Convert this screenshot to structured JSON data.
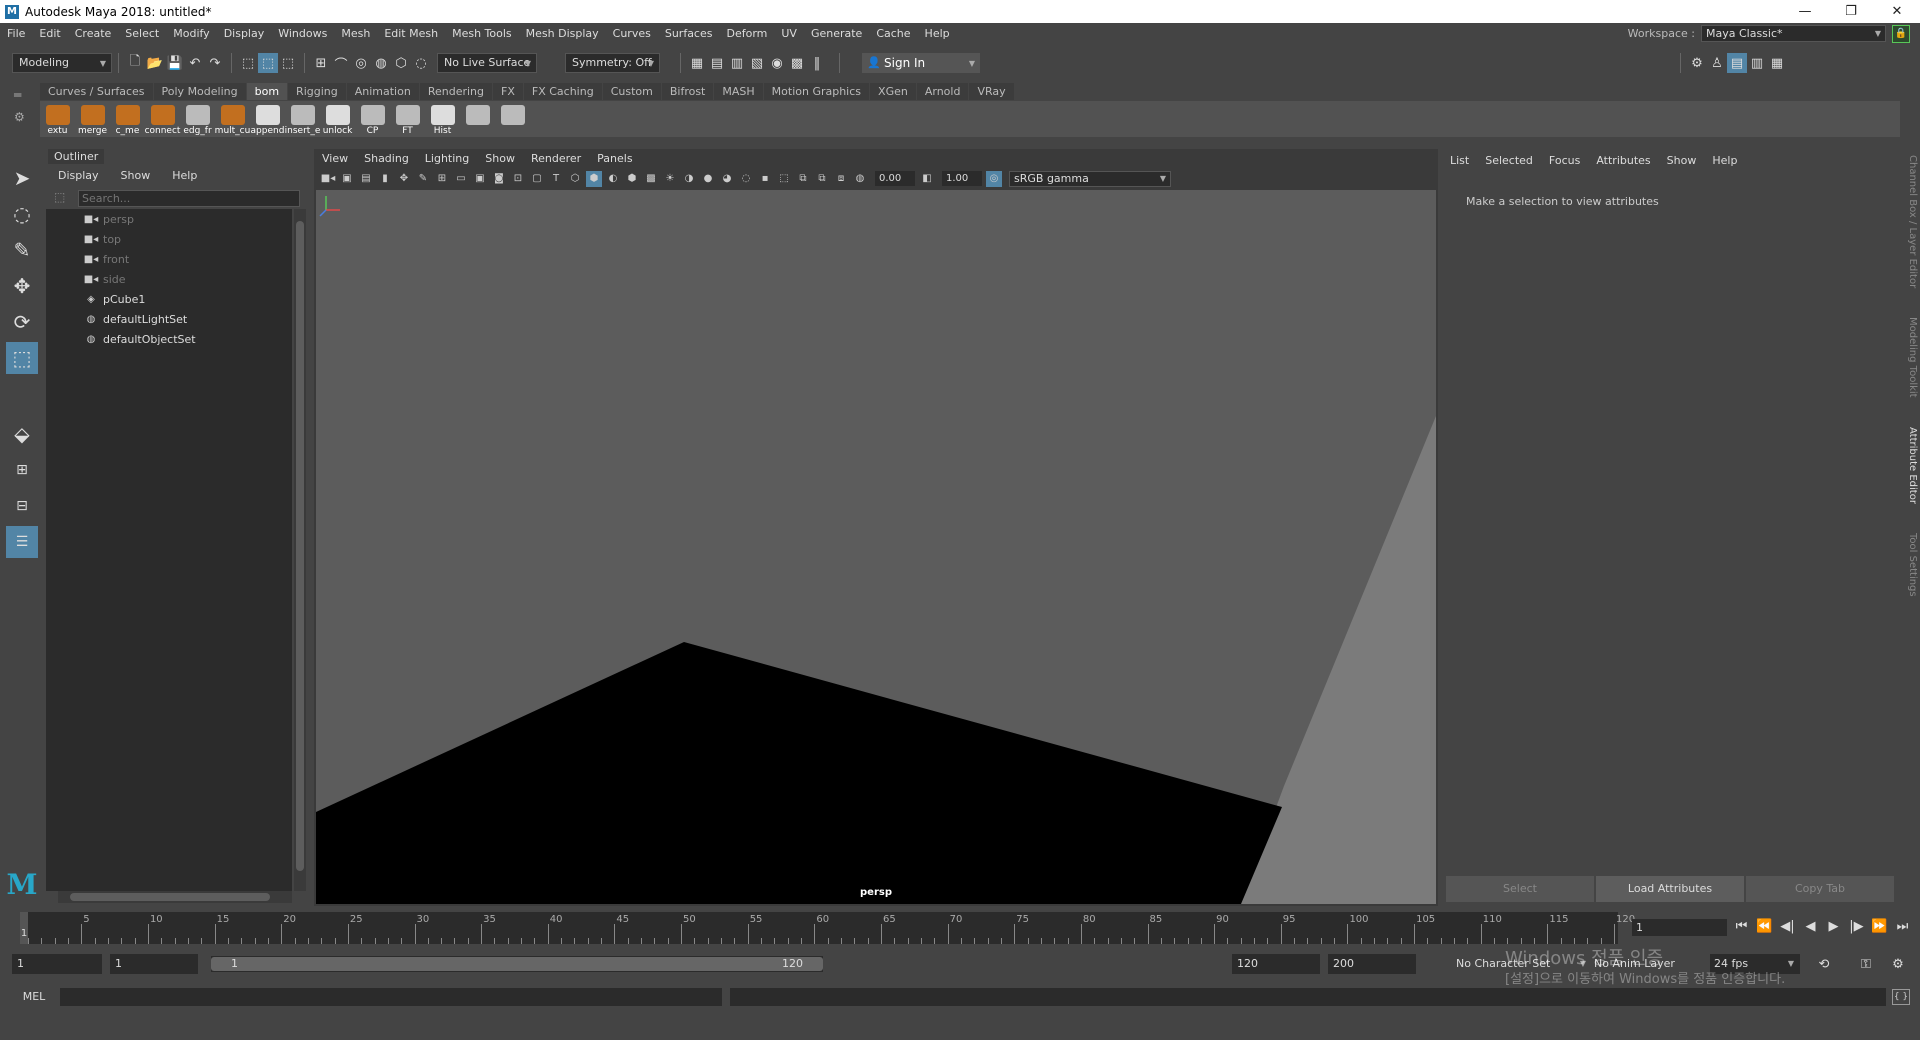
{
  "window": {
    "title": "Autodesk Maya 2018: untitled*",
    "app_icon": "M",
    "controls": [
      "—",
      "❐",
      "✕"
    ]
  },
  "menubar": [
    "File",
    "Edit",
    "Create",
    "Select",
    "Modify",
    "Display",
    "Windows",
    "Mesh",
    "Edit Mesh",
    "Mesh Tools",
    "Mesh Display",
    "Curves",
    "Surfaces",
    "Deform",
    "UV",
    "Generate",
    "Cache",
    "Help"
  ],
  "workspace": {
    "label": "Workspace :",
    "value": "Maya Classic*"
  },
  "statusline": {
    "menuset": "Modeling",
    "live_surface": "No Live Surface",
    "symmetry": "Symmetry: Off",
    "sign_in": "Sign In"
  },
  "shelf": {
    "tabs": [
      "Curves / Surfaces",
      "Poly Modeling",
      "bom",
      "Rigging",
      "Animation",
      "Rendering",
      "FX",
      "FX Caching",
      "Custom",
      "Bifrost",
      "MASH",
      "Motion Graphics",
      "XGen",
      "Arnold",
      "VRay"
    ],
    "active_tab": "bom",
    "buttons": [
      "extu",
      "merge",
      "c_me",
      "connect",
      "edg_fr",
      "mult_cu",
      "append",
      "insert_e",
      "unlock",
      "CP",
      "FT",
      "Hist"
    ]
  },
  "outliner": {
    "title": "Outliner",
    "menu": [
      "Display",
      "Show",
      "Help"
    ],
    "search_placeholder": "Search...",
    "items": [
      {
        "label": "persp",
        "icon": "camera-icon",
        "dim": true
      },
      {
        "label": "top",
        "icon": "camera-icon",
        "dim": true
      },
      {
        "label": "front",
        "icon": "camera-icon",
        "dim": true
      },
      {
        "label": "side",
        "icon": "camera-icon",
        "dim": true
      },
      {
        "label": "pCube1",
        "icon": "transform-icon",
        "dim": false
      },
      {
        "label": "defaultLightSet",
        "icon": "set-icon",
        "dim": false
      },
      {
        "label": "defaultObjectSet",
        "icon": "set-icon",
        "dim": false
      }
    ]
  },
  "viewport": {
    "menu": [
      "View",
      "Shading",
      "Lighting",
      "Show",
      "Renderer",
      "Panels"
    ],
    "exposure": "0.00",
    "gamma": "1.00",
    "color_space": "sRGB gamma",
    "camera_label": "persp"
  },
  "attribute_editor": {
    "menu": [
      "List",
      "Selected",
      "Focus",
      "Attributes",
      "Show",
      "Help"
    ],
    "message": "Make a selection to view attributes",
    "buttons": [
      "Select",
      "Load Attributes",
      "Copy Tab"
    ]
  },
  "side_tabs": [
    "Channel Box / Layer Editor",
    "Modeling Toolkit",
    "Attribute Editor",
    "Tool Settings"
  ],
  "timeline": {
    "labels": [
      "5",
      "10",
      "15",
      "20",
      "25",
      "30",
      "35",
      "40",
      "45",
      "50",
      "55",
      "60",
      "65",
      "70",
      "75",
      "80",
      "85",
      "90",
      "95",
      "100",
      "105",
      "110",
      "115",
      "120"
    ],
    "cursor_frame": "1",
    "current_frame": "1",
    "playback_icons": [
      "⏮",
      "⏪",
      "◀|",
      "◀",
      "▶",
      "|▶",
      "⏩",
      "⏭"
    ]
  },
  "range": {
    "start_time": "1",
    "playback_start": "1",
    "slider_start": "1",
    "slider_end": "120",
    "playback_end": "120",
    "end_time": "200",
    "character_set": "No Character Set",
    "anim_layer": "No Anim Layer",
    "fps": "24 fps"
  },
  "watermark": {
    "line1": "Windows 정품 인증",
    "line2": "[설정]으로 이동하여 Windows를 정품 인증합니다."
  },
  "cmdline": {
    "mode": "MEL"
  },
  "colors": {
    "accent": "#5285a6",
    "panel_bg": "#444444",
    "field_bg": "#2b2b2b",
    "viewport_bg": "#5c5c5c",
    "plane": "#7b7b7b",
    "cube": "#000000"
  }
}
